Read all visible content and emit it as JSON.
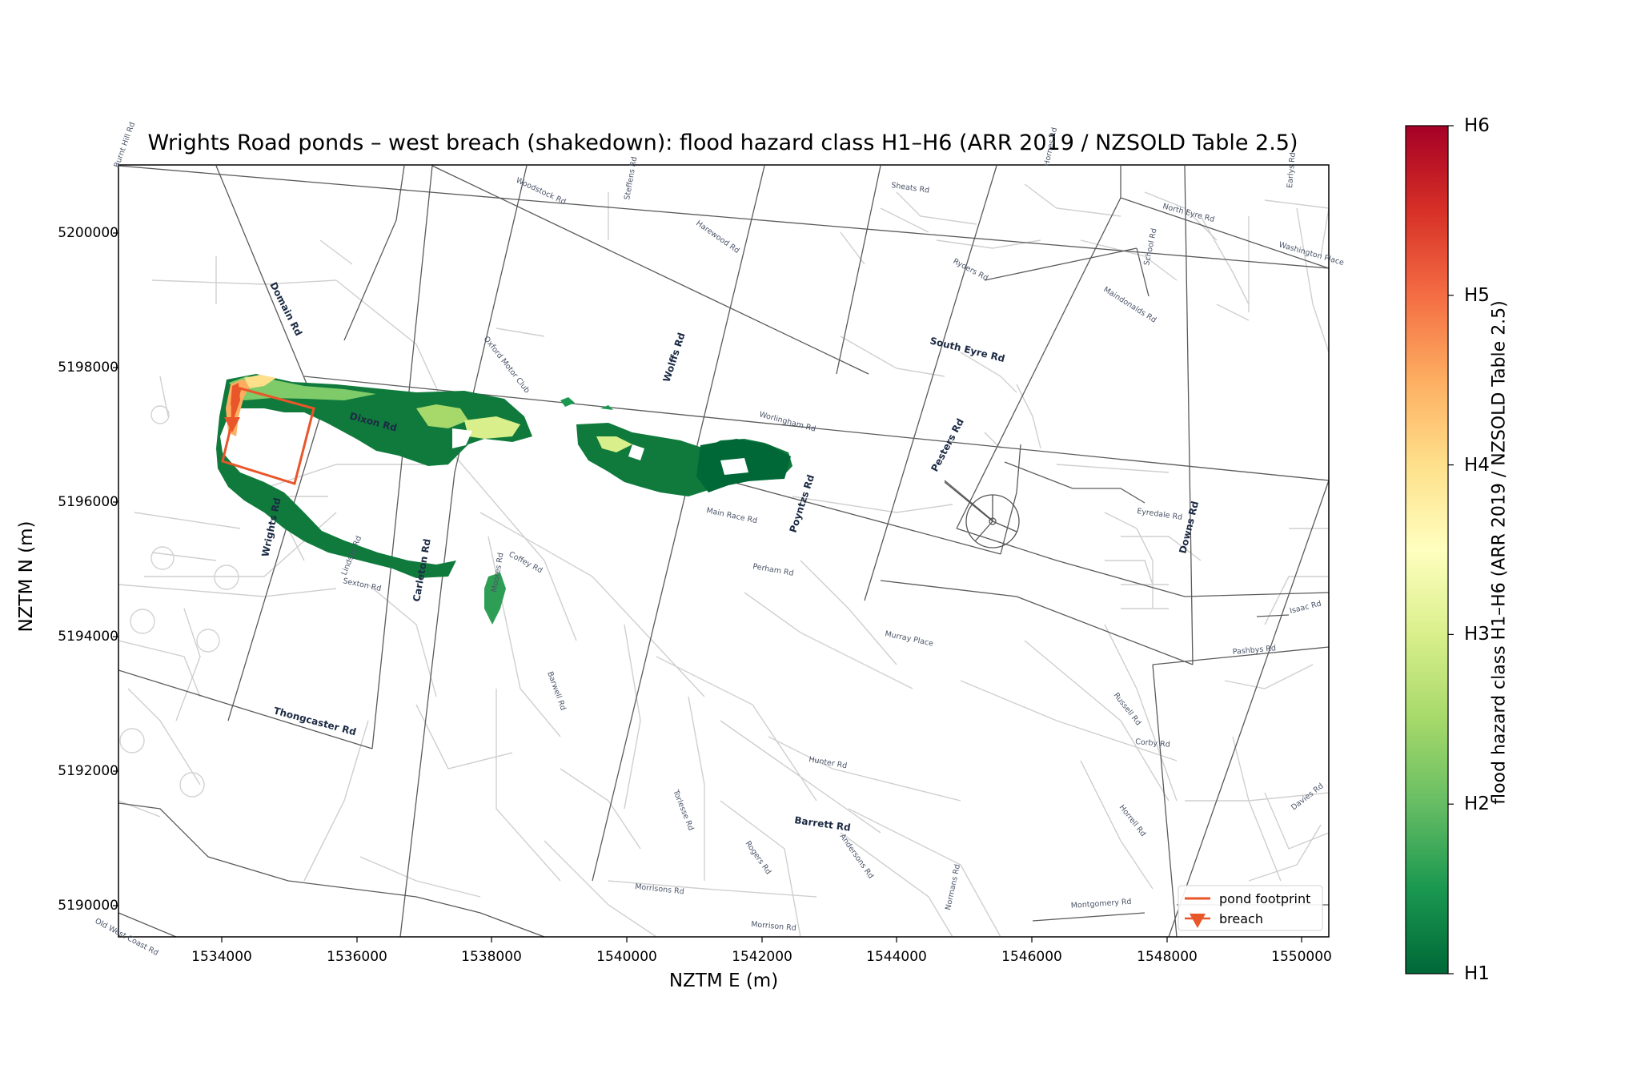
{
  "title": "Wrights Road ponds – west breach (shakedown): flood hazard class H1–H6 (ARR 2019 / NZSOLD Table 2.5)",
  "xlabel": "NZTM E (m)",
  "ylabel": "NZTM N (m)",
  "x_ticks": [
    "1534000",
    "1536000",
    "1538000",
    "1540000",
    "1542000",
    "1544000",
    "1546000",
    "1548000",
    "1550000"
  ],
  "y_ticks": [
    "5200000",
    "5198000",
    "5196000",
    "5194000",
    "5192000",
    "5190000"
  ],
  "colorbar": {
    "label": "flood hazard class H1–H6 (ARR 2019 / NZSOLD Table 2.5)",
    "ticks": [
      "H1",
      "H2",
      "H3",
      "H4",
      "H5",
      "H6"
    ],
    "colormap": "RdYlGn_r",
    "colors": [
      "#006837",
      "#1a9850",
      "#66bd63",
      "#a6d96a",
      "#d9ef8b",
      "#ffffbf",
      "#fee08b",
      "#fdae61",
      "#f46d43",
      "#d73027",
      "#a50026"
    ]
  },
  "legend": {
    "position": "lower-right",
    "items": [
      {
        "label": "pond footprint",
        "color": "#e8562a",
        "marker": "line"
      },
      {
        "label": "breach",
        "color": "#e8562a",
        "marker": "down-triangle"
      }
    ]
  },
  "road_labels": {
    "major": [
      "Domain Rd",
      "Dixon Rd",
      "Wolffs Rd",
      "South Eyre Rd",
      "Poyntzs Rd",
      "Pesters Rd",
      "Downs Rd",
      "Wrights Rd",
      "Carleton Rd",
      "Thongcaster Rd",
      "Barrett Rd"
    ],
    "minor": [
      "Burnt Hill Rd",
      "Woodstock Rd",
      "Steffens Rd",
      "Harewood Rd",
      "Sheats Rd",
      "Hornes Rd",
      "North Eyre Rd",
      "Earlys Rd",
      "Washington Place",
      "Ryders Rd",
      "Maindonalds Rd",
      "School Rd",
      "Oxford Motor Club",
      "Worlingham Rd",
      "Main Race Rd",
      "Eyredale Rd",
      "Coffey Rd",
      "Lindsay Rd",
      "Sexton Rd",
      "Moores Rd",
      "Perham Rd",
      "Murray Place",
      "Isaac Rd",
      "Pashbys Rd",
      "Barwell Rd",
      "Russell Rd",
      "Corby Rd",
      "Hunter Rd",
      "Horrell Rd",
      "Davies Rd",
      "Torlesse Rd",
      "Rogers Rd",
      "Andersons Rd",
      "Morrisons Rd",
      "Normans Rd",
      "Morrison Rd",
      "Montgomery Rd",
      "Old West Coast Rd"
    ]
  }
}
